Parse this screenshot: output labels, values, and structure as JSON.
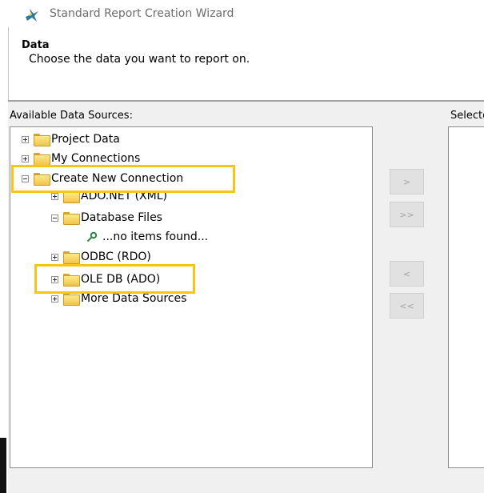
{
  "window": {
    "title": "Standard Report Creation Wizard"
  },
  "header": {
    "title": "Data",
    "subtitle": "Choose the data you want to report on."
  },
  "available": {
    "label": "Available Data Sources:"
  },
  "selected": {
    "label": "Selected Tables:"
  },
  "tree": {
    "project_data": "Project Data",
    "my_connections": "My Connections",
    "create_new_connection": "Create New Connection",
    "ado_net": "ADO.NET (XML)",
    "database_files": "Database Files",
    "no_items": "...no items found...",
    "odbc": "ODBC (RDO)",
    "ole_db": "OLE DB (ADO)",
    "more_sources": "More Data Sources"
  },
  "buttons": {
    "add": ">",
    "add_all": ">>",
    "remove": "<",
    "remove_all": "<<"
  },
  "colors": {
    "highlight": "#f5c518",
    "folder": "#f0c54a",
    "panel": "#f0f0f0"
  }
}
